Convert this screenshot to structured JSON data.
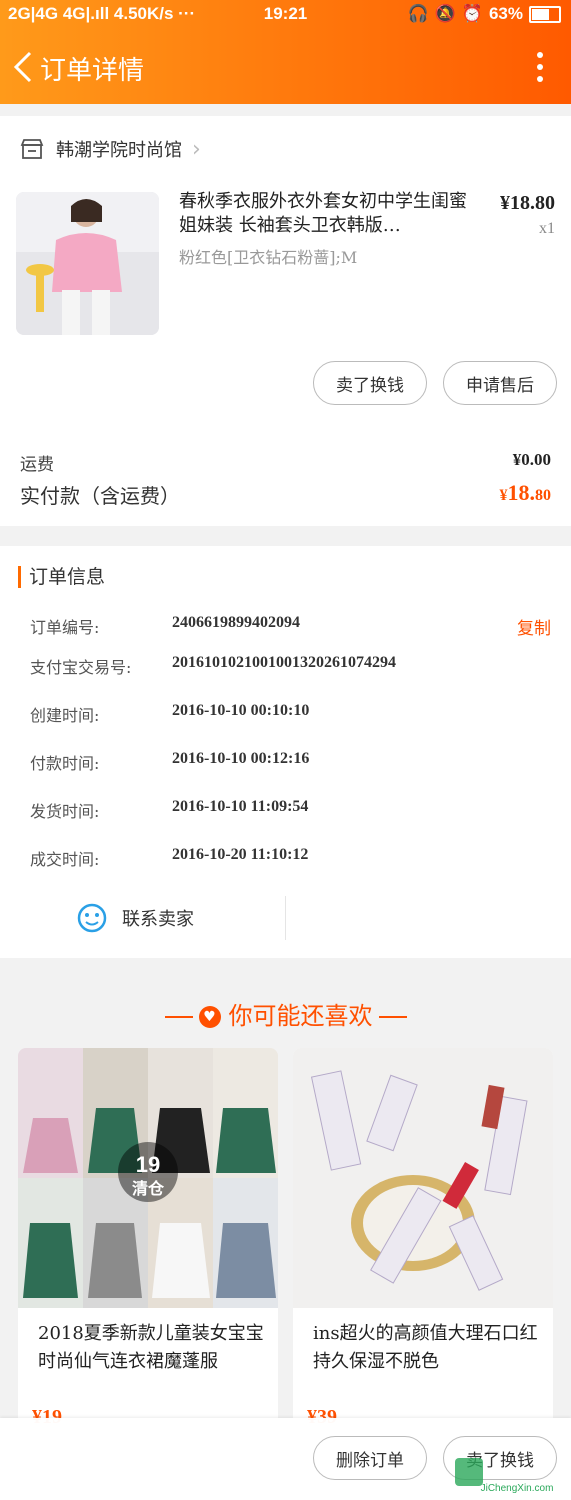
{
  "status_bar": {
    "left": "2G|4G 4G|.ıll 4.50K/s ···",
    "time": "19:21",
    "battery": "63%"
  },
  "header": {
    "title": "订单详情"
  },
  "shop": {
    "name": "韩潮学院时尚馆"
  },
  "product": {
    "title": "春秋季衣服外衣外套女初中学生闺蜜姐妹装 长袖套头卫衣韩版…",
    "price": "¥18.80",
    "qty": "x1",
    "sku": "粉红色[卫衣钻石粉蔷];M",
    "btn_buy_again": "卖了换钱",
    "btn_after_sale": "申请售后"
  },
  "summary": {
    "shipping_label": "运费",
    "shipping_value": "¥0.00",
    "paid_label": "实付款（含运费）",
    "paid_symbol": "¥",
    "paid_int": "18.",
    "paid_dec": "80"
  },
  "order_info": {
    "title": "订单信息",
    "copy_label": "复制",
    "rows": [
      {
        "label": "订单编号:",
        "value": "2406619899402094"
      },
      {
        "label": "支付宝交易号:",
        "value": "2016101021001001320261074294"
      },
      {
        "label": "创建时间:",
        "value": "2016-10-10 00:10:10"
      },
      {
        "label": "付款时间:",
        "value": "2016-10-10 00:12:16"
      },
      {
        "label": "发货时间:",
        "value": "2016-10-10 11:09:54"
      },
      {
        "label": "成交时间:",
        "value": "2016-10-20 11:10:12"
      }
    ],
    "contact_label": "联系卖家"
  },
  "recommend": {
    "title": "你可能还喜欢",
    "items": [
      {
        "name": "2018夏季新款儿童装女宝宝时尚仙气连衣裙魔蓬服",
        "price": "¥19",
        "badge_num": "19",
        "badge_text": "清仓"
      },
      {
        "name": "ins超火的高颜值大理石口红持久保湿不脱色",
        "price": "¥39"
      }
    ]
  },
  "bottom_bar": {
    "delete_label": "删除订单",
    "sell_label": "卖了换钱",
    "watermark": "JiChengXin.com"
  },
  "colors": {
    "accent": "#ff5000",
    "header_start": "#ff9a1a",
    "header_end": "#ff5a00"
  }
}
